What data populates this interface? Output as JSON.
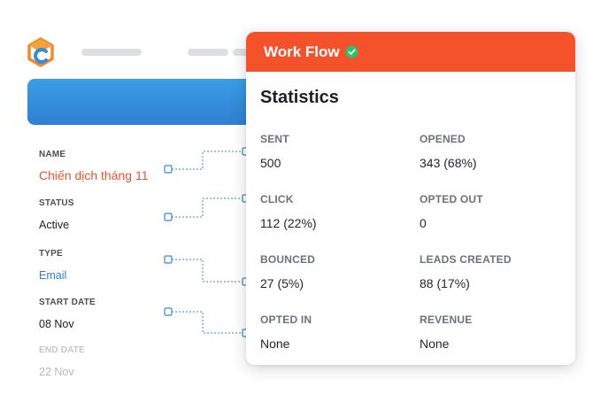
{
  "form": {
    "fields": [
      {
        "label": "NAME",
        "value": "Chiến dịch tháng 11"
      },
      {
        "label": "STATUS",
        "value": "Active"
      },
      {
        "label": "TYPE",
        "value": "Email"
      },
      {
        "label": "START DATE",
        "value": "08 Nov"
      },
      {
        "label": "END DATE",
        "value": "22 Nov"
      }
    ]
  },
  "card": {
    "title": "Work Flow",
    "subtitle": "Statistics",
    "stats": [
      {
        "label": "SENT",
        "value": "500"
      },
      {
        "label": "OPENED",
        "value": "343 (68%)"
      },
      {
        "label": "CLICK",
        "value": "112 (22%)"
      },
      {
        "label": "OPTED OUT",
        "value": "0"
      },
      {
        "label": "BOUNCED",
        "value": "27 (5%)"
      },
      {
        "label": "LEADS CREATED",
        "value": "88 (17%)"
      },
      {
        "label": "OPTED IN",
        "value": "None"
      },
      {
        "label": "REVENUE",
        "value": "None"
      }
    ]
  },
  "colors": {
    "header": "#f4522b",
    "banner": "#2f7fd2",
    "name_value": "#ea5433",
    "type_value": "#2f80d3",
    "verified": "#2fbf71"
  },
  "icons": {
    "logo": "brand-hexagon-logo-icon",
    "verified": "check-circle-icon"
  }
}
